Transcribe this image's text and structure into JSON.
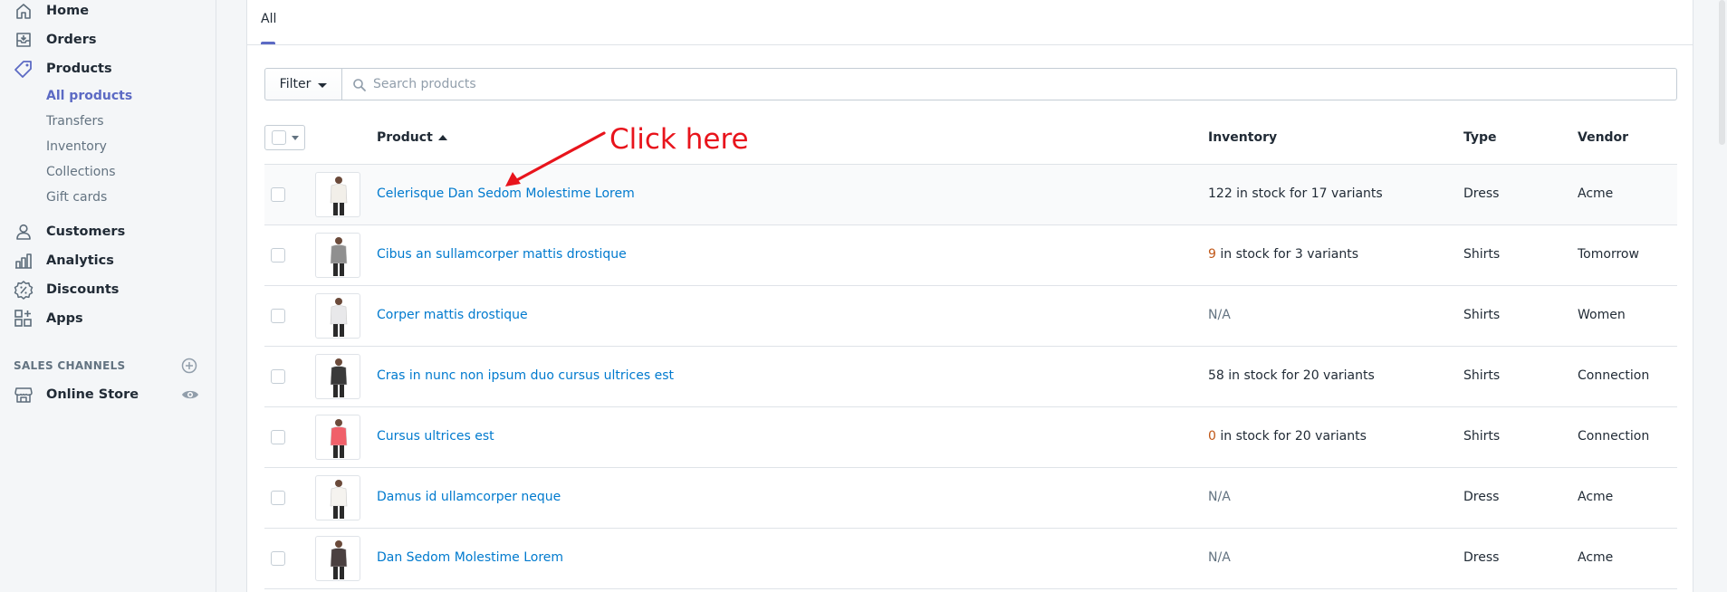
{
  "sidebar": {
    "nav": [
      {
        "label": "Home",
        "icon": "home-icon"
      },
      {
        "label": "Orders",
        "icon": "orders-icon"
      },
      {
        "label": "Products",
        "icon": "tag-icon"
      },
      {
        "label": "Customers",
        "icon": "person-icon"
      },
      {
        "label": "Analytics",
        "icon": "chart-icon"
      },
      {
        "label": "Discounts",
        "icon": "discount-icon"
      },
      {
        "label": "Apps",
        "icon": "apps-icon"
      }
    ],
    "product_subnav": [
      "All products",
      "Transfers",
      "Inventory",
      "Collections",
      "Gift cards"
    ],
    "active_subitem": "All products",
    "sales_channels_heading": "SALES CHANNELS",
    "online_store": "Online Store"
  },
  "tabs": [
    "All"
  ],
  "filter": {
    "button_label": "Filter",
    "search_placeholder": "Search products"
  },
  "table": {
    "columns": {
      "product": "Product",
      "inventory": "Inventory",
      "type": "Type",
      "vendor": "Vendor"
    },
    "rows": [
      {
        "product": "Celerisque Dan Sedom Molestime Lorem",
        "inv_count": "",
        "inv_text": "122 in stock for 17 variants",
        "type": "Dress",
        "vendor": "Acme",
        "thumb_color": "#f2efe9"
      },
      {
        "product": "Cibus an sullamcorper mattis drostique",
        "inv_count": "9",
        "inv_text": " in stock for 3 variants",
        "type": "Shirts",
        "vendor": "Tomorrow",
        "thumb_color": "#8f8f8f"
      },
      {
        "product": "Corper mattis drostique",
        "inv_count": "",
        "inv_text": "N/A",
        "type": "Shirts",
        "vendor": "Women",
        "thumb_color": "#e8e8ea"
      },
      {
        "product": "Cras in nunc non ipsum duo cursus ultrices est",
        "inv_count": "",
        "inv_text": "58 in stock for 20 variants",
        "type": "Shirts",
        "vendor": "Connection",
        "thumb_color": "#3a3a3a"
      },
      {
        "product": "Cursus ultrices est",
        "inv_count": "0",
        "inv_text": " in stock for 20 variants",
        "type": "Shirts",
        "vendor": "Connection",
        "thumb_color": "#f0606a"
      },
      {
        "product": "Damus id ullamcorper neque",
        "inv_count": "",
        "inv_text": "N/A",
        "type": "Dress",
        "vendor": "Acme",
        "thumb_color": "#f5f3ef"
      },
      {
        "product": "Dan Sedom Molestime Lorem",
        "inv_count": "",
        "inv_text": "N/A",
        "type": "Dress",
        "vendor": "Acme",
        "thumb_color": "#4a4040"
      }
    ]
  },
  "annotation": "Click here",
  "colors": {
    "accent": "#5c6ac4",
    "link": "#007ace",
    "annotation": "#e8141c",
    "warning": "#c05717"
  }
}
